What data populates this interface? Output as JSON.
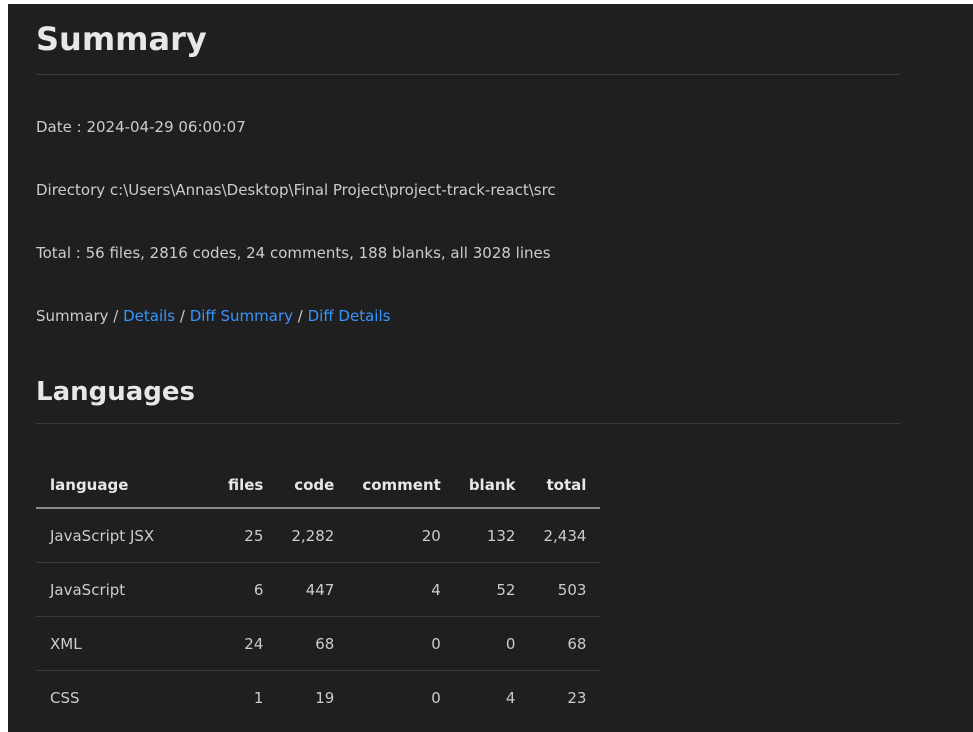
{
  "summary": {
    "title": "Summary",
    "date_line": "Date : 2024-04-29 06:00:07",
    "directory_line": "Directory c:\\Users\\Annas\\Desktop\\Final Project\\project-track-react\\src",
    "total_line": "Total : 56 files, 2816 codes, 24 comments, 188 blanks, all 3028 lines"
  },
  "nav": {
    "current": "Summary",
    "sep": " / ",
    "details": "Details",
    "diff_summary": "Diff Summary",
    "diff_details": "Diff Details"
  },
  "languages": {
    "title": "Languages",
    "headers": [
      "language",
      "files",
      "code",
      "comment",
      "blank",
      "total"
    ],
    "rows": [
      [
        "JavaScript JSX",
        "25",
        "2,282",
        "20",
        "132",
        "2,434"
      ],
      [
        "JavaScript",
        "6",
        "447",
        "4",
        "52",
        "503"
      ],
      [
        "XML",
        "24",
        "68",
        "0",
        "0",
        "68"
      ],
      [
        "CSS",
        "1",
        "19",
        "0",
        "4",
        "23"
      ]
    ]
  },
  "colors": {
    "background": "#1f1f1f",
    "text": "#cccccc",
    "link": "#3794ff"
  }
}
